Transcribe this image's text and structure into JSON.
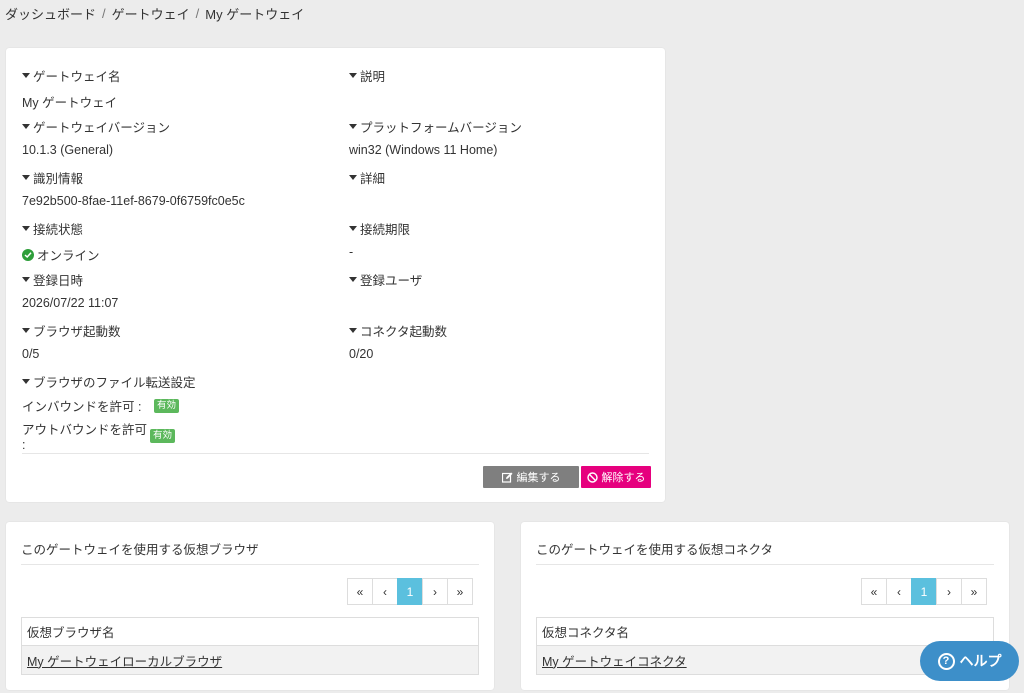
{
  "breadcrumb": [
    "ダッシュボード",
    "ゲートウェイ",
    "My ゲートウェイ"
  ],
  "fields": {
    "gateway_name": {
      "label": "ゲートウェイ名",
      "value": "My ゲートウェイ"
    },
    "description": {
      "label": "説明",
      "value": ""
    },
    "gateway_version": {
      "label": "ゲートウェイバージョン",
      "value": "10.1.3 (General)"
    },
    "platform_version": {
      "label": "プラットフォームバージョン",
      "value": "win32 (Windows 11 Home)"
    },
    "identifier": {
      "label": "識別情報",
      "value": "7e92b500-8fae-11ef-8679-0f6759fc0e5c"
    },
    "details": {
      "label": "詳細",
      "value": ""
    },
    "connection_status": {
      "label": "接続状態",
      "value": "オンライン"
    },
    "connection_expiry": {
      "label": "接続期限",
      "value": "-"
    },
    "registered_at": {
      "label": "登録日時",
      "value": "2026/07/22 11:07"
    },
    "registered_user": {
      "label": "登録ユーザ",
      "value": ""
    },
    "browser_count": {
      "label": "ブラウザ起動数",
      "value": "0/5"
    },
    "connector_count": {
      "label": "コネクタ起動数",
      "value": "0/20"
    },
    "file_transfer": {
      "label": "ブラウザのファイル転送設定",
      "inbound_label": "インバウンドを許可 :",
      "inbound_value": "有効",
      "outbound_label": "アウトバウンドを許可 :",
      "outbound_value": "有効"
    }
  },
  "buttons": {
    "edit": "編集する",
    "release": "解除する"
  },
  "browsers_panel": {
    "title": "このゲートウェイを使用する仮想ブラウザ",
    "pager": [
      "«",
      "‹",
      "1",
      "›",
      "»"
    ],
    "column": "仮想ブラウザ名",
    "rows": [
      "My ゲートウェイローカルブラウザ"
    ]
  },
  "connectors_panel": {
    "title": "このゲートウェイを使用する仮想コネクタ",
    "pager": [
      "«",
      "‹",
      "1",
      "›",
      "»"
    ],
    "column": "仮想コネクタ名",
    "rows": [
      "My ゲートウェイコネクタ"
    ]
  },
  "help": {
    "label": "ヘルプ"
  },
  "colors": {
    "online": "#2e9e3a",
    "badge": "#5cb85c",
    "edit_button": "#7f7f7f",
    "release_button": "#e6007e",
    "pager_active": "#5bc0de",
    "help_button": "#3d8fc9"
  },
  "icons": {
    "caret": "caret-down-icon",
    "online": "check-circle-icon",
    "edit": "edit-icon",
    "release": "ban-icon",
    "help": "question-circle-icon"
  }
}
